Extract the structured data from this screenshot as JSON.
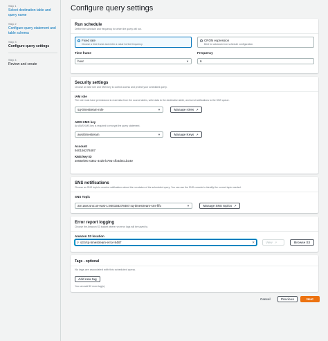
{
  "sidebar": {
    "steps": [
      {
        "num": "Step 1",
        "label": "Select destination table and query name"
      },
      {
        "num": "Step 2",
        "label": "Configure query statement and table schema"
      },
      {
        "num": "Step 3",
        "label": "Configure query settings"
      },
      {
        "num": "Step 4",
        "label": "Review and create"
      }
    ]
  },
  "page_title": "Configure query settings",
  "run_schedule": {
    "title": "Run schedule",
    "desc": "Define the schedule and frequency for when the query will run.",
    "options": [
      {
        "title": "Fixed rate",
        "desc": "Choose a time frame and enter a value for the frequency.",
        "selected": true
      },
      {
        "title": "CRON expression",
        "desc": "Best for advanced run schedule configuration.",
        "selected": false
      }
    ],
    "time_frame_label": "Time frame",
    "time_frame_value": "hour",
    "frequency_label": "Frequency",
    "frequency_value": "6"
  },
  "security": {
    "title": "Security settings",
    "desc": "Choose an IAM role and KMS key to control access and protect your scheduled query.",
    "iam_label": "IAM role",
    "iam_desc": "The role must have permissions to read data from the source tables, write data to the destination table, and send notifications to the SNS queue.",
    "iam_value": "sq-timestream-role",
    "manage_roles": "Manage roles",
    "kms_label": "AWS KMS key",
    "kms_desc": "An AWS KMS key is required to encrypt the query statement.",
    "kms_value": "aws/timestream",
    "manage_keys": "Manage Keys",
    "account_label": "Account",
    "account_value": "940156278487",
    "kms_id_label": "KMS key ID",
    "kms_id_value": "3e55eb9c-0361-44d5-b79a-cfb4d0c1b34e"
  },
  "sns": {
    "title": "SNS notifications",
    "desc": "Choose an SNS topic to receive notifications about the run status of the scheduled query. You can use the SNS console to identify the correct topic needed.",
    "topic_label": "SNS Topic",
    "topic_value": "arn:aws:sns:us-east-1:940156278487:sq-timestream-sns-fifo",
    "manage_topics": "Manage SNS topics"
  },
  "error_report": {
    "title": "Error report logging",
    "desc": "Choose the Amazon S3 bucket where run error logs will be saved to.",
    "location_label": "Amazon S3 location",
    "location_value": "s3://sq-timestream-error-8487",
    "view": "View",
    "browse": "Browse S3"
  },
  "tags": {
    "title": "Tags - optional",
    "empty": "No tags are associated with this scheduled query.",
    "add": "Add new tag",
    "remaining": "You can add 50 more tag(s)."
  },
  "footer": {
    "cancel": "Cancel",
    "previous": "Previous",
    "next": "Next"
  },
  "colors": {
    "accent": "#0073bb",
    "primary_button": "#ec7211"
  }
}
